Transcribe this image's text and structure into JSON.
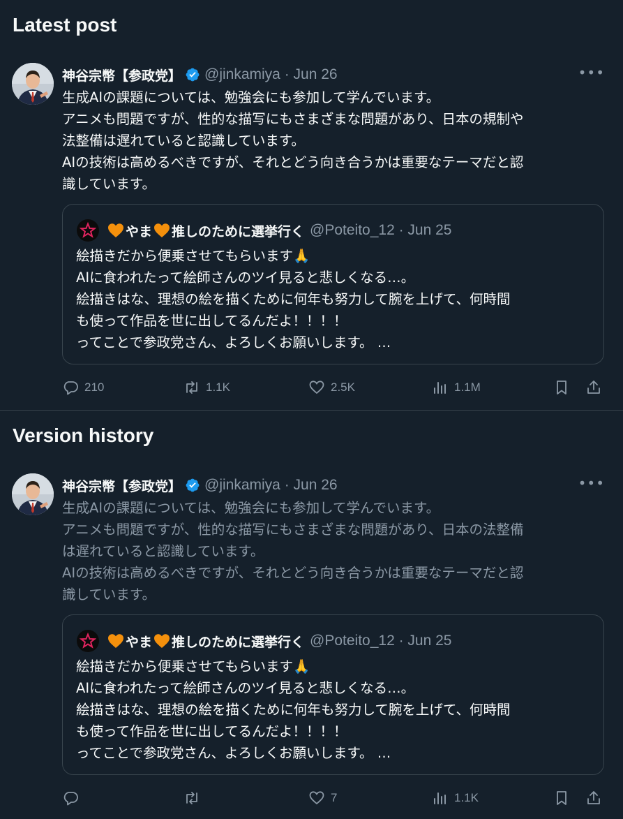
{
  "sections": {
    "latest_title": "Latest post",
    "history_title": "Version history"
  },
  "latest": {
    "author": "神谷宗幣【参政党】",
    "handle_date": "@jinkamiya · Jun 26",
    "lines": [
      "生成AIの課題については、勉強会にも参加して学んでいます。",
      "アニメも問題ですが、性的な描写にもさまざまな問題があり、日本の規制や",
      "法整備は遅れていると認識しています。",
      "AIの技術は高めるべきですが、それとどう向き合うかは重要なテーマだと認",
      "識しています。"
    ],
    "quote": {
      "name_a": "やま",
      "name_b": "推しのために選挙行く",
      "handle_date": "@Poteito_12 · Jun 25",
      "lines": [
        "絵描きだから便乗させてもらいます🙏",
        "AIに食われたって絵師さんのツイ見ると悲しくなる…。",
        "絵描きはな、理想の絵を描くために何年も努力して腕を上げて、何時間",
        "も使って作品を世に出してるんだよ！！！！",
        "ってことで参政党さん、よろしくお願いします。 …"
      ]
    },
    "actions": {
      "replies": "210",
      "reposts": "1.1K",
      "likes": "2.5K",
      "views": "1.1M"
    }
  },
  "history": {
    "author": "神谷宗幣【参政党】",
    "handle_date": "@jinkamiya · Jun 26",
    "lines": [
      "生成AIの課題については、勉強会にも参加して学んでいます。",
      "アニメも問題ですが、性的な描写にもさまざまな問題があり、日本の法整備",
      "は遅れていると認識しています。",
      "AIの技術は高めるべきですが、それとどう向き合うかは重要なテーマだと認",
      "識しています。"
    ],
    "quote": {
      "name_a": "やま",
      "name_b": "推しのために選挙行く",
      "handle_date": "@Poteito_12 · Jun 25",
      "lines": [
        "絵描きだから便乗させてもらいます🙏",
        "AIに食われたって絵師さんのツイ見ると悲しくなる…。",
        "絵描きはな、理想の絵を描くために何年も努力して腕を上げて、何時間",
        "も使って作品を世に出してるんだよ！！！！",
        "ってことで参政党さん、よろしくお願いします。 …"
      ]
    },
    "actions": {
      "replies": "",
      "reposts": "",
      "likes": "7",
      "views": "1.1K"
    }
  },
  "icons": {
    "reply": "reply-icon",
    "repost": "repost-icon",
    "like": "heart-icon",
    "views": "views-icon",
    "bookmark": "bookmark-icon",
    "share": "share-icon",
    "more": "more-icon",
    "verified": "verified-badge-icon"
  },
  "colors": {
    "background": "#15202b",
    "text": "#f7f9f9",
    "secondary": "#8b98a5",
    "border": "#38444d",
    "verified": "#1d9bf0",
    "heart_emoji": "#f4900c"
  }
}
